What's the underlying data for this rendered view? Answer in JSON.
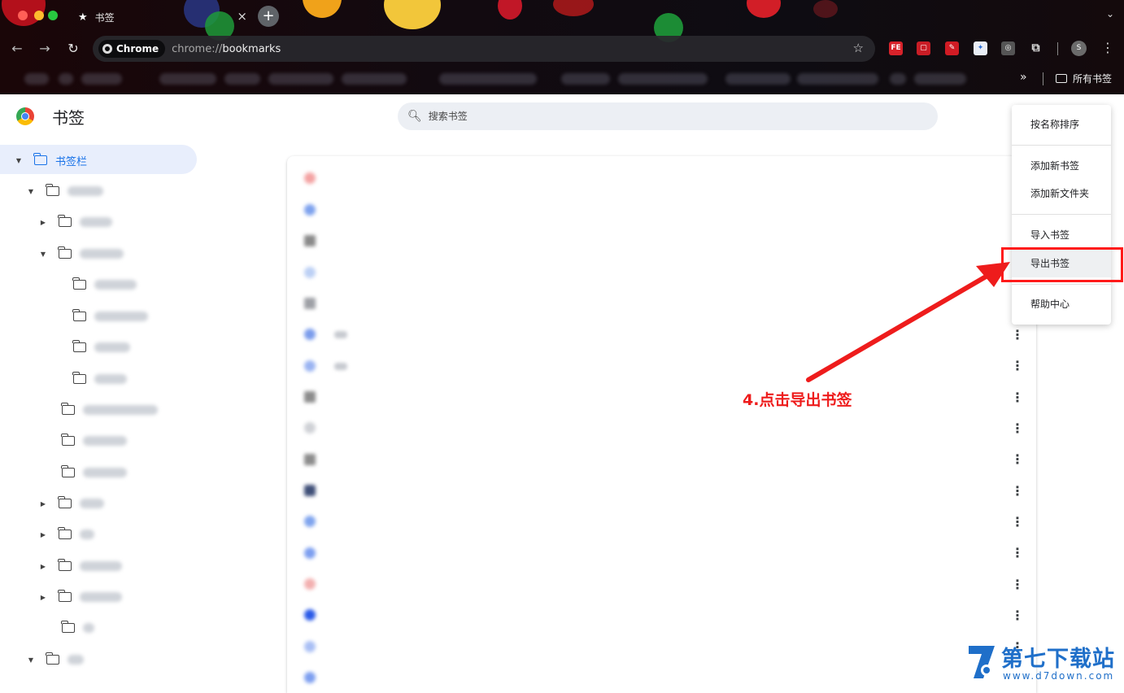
{
  "browser": {
    "tab_title": "书签",
    "tab_close": "×",
    "new_tab": "+",
    "chip_label": "Chrome",
    "url_scheme": "chrome://",
    "url_path": "bookmarks",
    "profile_initial": "S",
    "ext_label": "FE",
    "bookmarks_more": "»",
    "all_bookmarks": "所有书签"
  },
  "page": {
    "title": "书签",
    "search_placeholder": "搜索书签"
  },
  "sidebar": {
    "root_label": "书签栏"
  },
  "menu": {
    "items": [
      "按名称排序",
      "添加新书签",
      "添加新文件夹",
      "导入书签",
      "导出书签",
      "帮助中心"
    ]
  },
  "annotation": {
    "text": "4.点击导出书签",
    "color": "#ee1c1c"
  },
  "watermark": {
    "name": "第七下载站",
    "url": "www.d7down.com"
  },
  "colors": {
    "accent": "#1a73e8",
    "highlight": "#ff1a1a"
  }
}
